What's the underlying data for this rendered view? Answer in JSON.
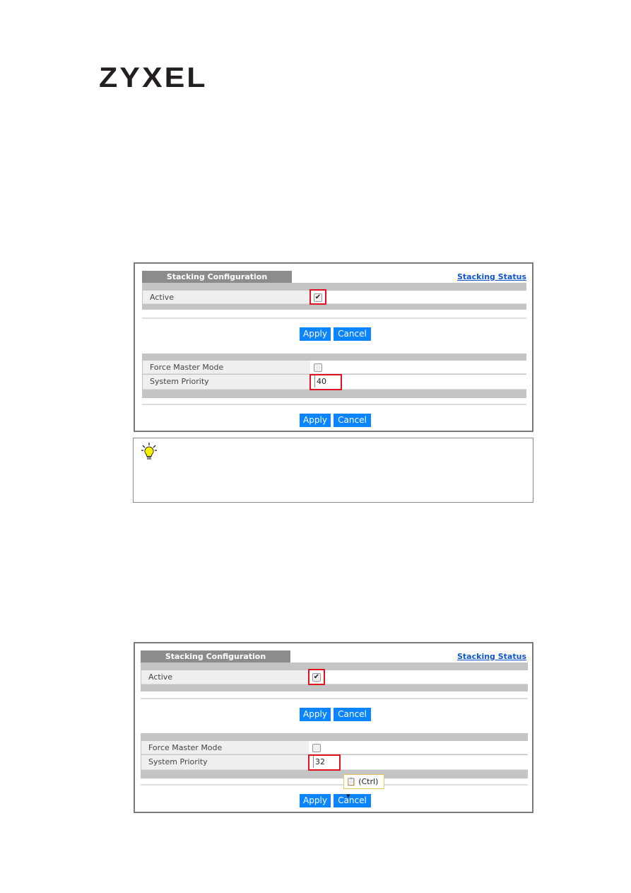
{
  "logo": "ZYXEL",
  "panels": [
    {
      "tab": "Stacking Configuration",
      "status_link": "Stacking Status",
      "active_label": "Active",
      "active_checked": true,
      "force_master_label": "Force Master Mode",
      "force_master_checked": false,
      "priority_label": "System Priority",
      "priority_value": "40",
      "apply": "Apply",
      "cancel": "Cancel"
    },
    {
      "tab": "Stacking Configuration",
      "status_link": "Stacking Status",
      "active_label": "Active",
      "active_checked": true,
      "force_master_label": "Force Master Mode",
      "force_master_checked": false,
      "priority_label": "System Priority",
      "priority_value": "32",
      "apply": "Apply",
      "cancel": "Cancel",
      "paste_popup": "(Ctrl)"
    }
  ],
  "tip": {
    "icon": "lightbulb-icon"
  },
  "colors": {
    "button": "#0a84ff",
    "highlight": "#e0141e",
    "link": "#1155cc"
  }
}
